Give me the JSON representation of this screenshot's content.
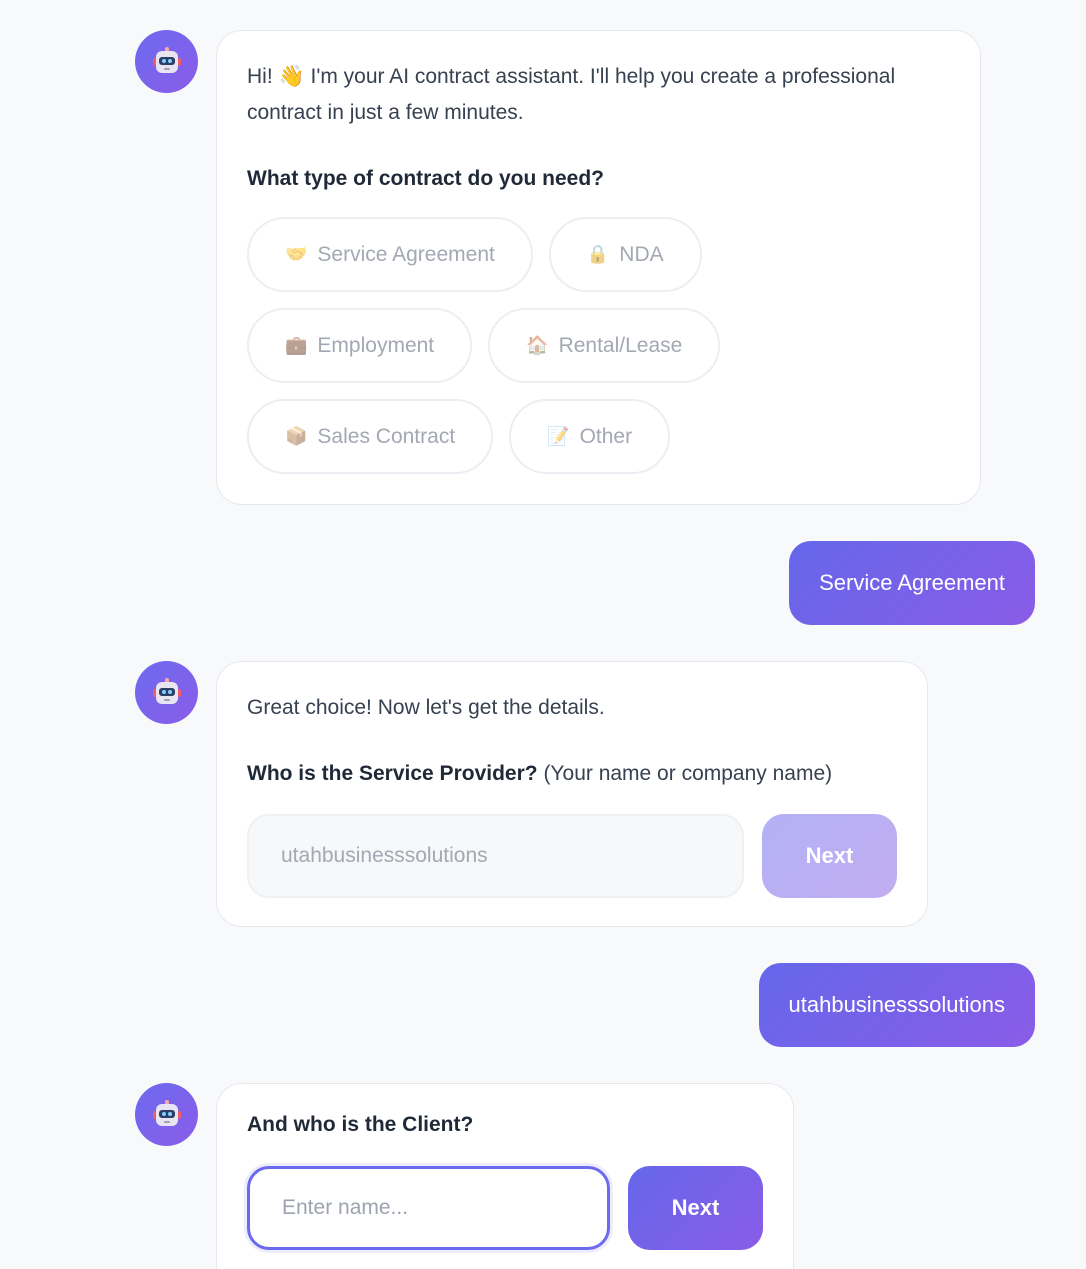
{
  "messages": {
    "bot1": {
      "greeting": "Hi! 👋 I'm your AI contract assistant. I'll help you create a professional contract in just a few minutes.",
      "question": "What type of contract do you need?",
      "options": [
        {
          "icon": "🤝",
          "label": "Service Agreement"
        },
        {
          "icon": "🔒",
          "label": "NDA"
        },
        {
          "icon": "💼",
          "label": "Employment"
        },
        {
          "icon": "🏠",
          "label": "Rental/Lease"
        },
        {
          "icon": "📦",
          "label": "Sales Contract"
        },
        {
          "icon": "📝",
          "label": "Other"
        }
      ]
    },
    "user1": "Service Agreement",
    "bot2": {
      "text": "Great choice! Now let's get the details.",
      "question": "Who is the Service Provider?",
      "question_note": "(Your name or company name)",
      "input_value": "utahbusinesssolutions",
      "next_label": "Next"
    },
    "user2": "utahbusinesssolutions",
    "bot3": {
      "question": "And who is the Client?",
      "input_placeholder": "Enter name...",
      "next_label": "Next"
    }
  },
  "colors": {
    "accent_start": "#6567ea",
    "accent_end": "#8a5ce8",
    "background": "#f8f9fb"
  },
  "avatar_icon": "robot-icon"
}
